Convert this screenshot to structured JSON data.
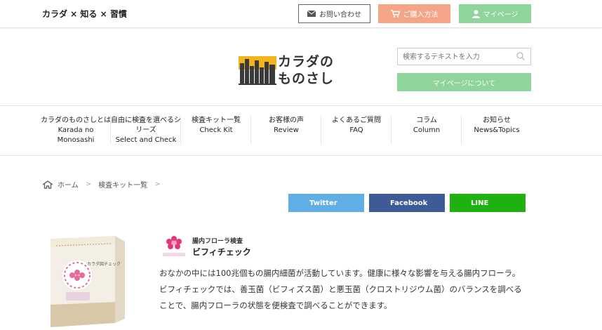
{
  "topbar": {
    "tagline": "カラダ × 知る × 習慣",
    "contact_label": "お問い合わせ",
    "purchase_label": "ご購入方法",
    "mypage_label": "マイページ"
  },
  "header": {
    "logo_line1": "カラダの",
    "logo_line2": "ものさし",
    "search_placeholder": "検索するテキストを入力",
    "mypage_about_label": "マイページについて"
  },
  "nav": {
    "items": [
      {
        "line1": "カラダのものさしとは",
        "line2": "Karada no",
        "line3": "Monosashi"
      },
      {
        "line1": "自由に検査を選べるシ",
        "line2": "リーズ",
        "line3": "Select and Check"
      },
      {
        "line1": "検査キット一覧",
        "line2": "Check Kit",
        "line3": ""
      },
      {
        "line1": "お客様の声",
        "line2": "Review",
        "line3": ""
      },
      {
        "line1": "よくあるご質問",
        "line2": "FAQ",
        "line3": ""
      },
      {
        "line1": "コラム",
        "line2": "Column",
        "line3": ""
      },
      {
        "line1": "お知らせ",
        "line2": "News&Topics",
        "line3": ""
      }
    ]
  },
  "breadcrumb": {
    "home": "ホーム",
    "current": "検査キット一覧"
  },
  "share": {
    "twitter": "Twitter",
    "facebook": "Facebook",
    "line": "LINE"
  },
  "product": {
    "category": "腸内フローラ検査",
    "name": "ビフィチェック",
    "package_title": "カラダ図チェック",
    "description": [
      "おなかの中には100兆個もの腸内細菌が活動しています。健康に様々な影響を与える腸内フローラ。",
      "ビフィチェックでは、善玉菌（ビフィズス菌）と悪玉菌（クロストリジウム菌）のバランスを調べる",
      "ことで、腸内フローラの状態を便検査で調べることができます。"
    ]
  },
  "colors": {
    "accent_green": "#8fd49a",
    "accent_orange": "#f4a588",
    "twitter": "#60aee6",
    "facebook": "#3e5b98",
    "line": "#1fb10f",
    "logo_yellow": "#f2b51c"
  }
}
